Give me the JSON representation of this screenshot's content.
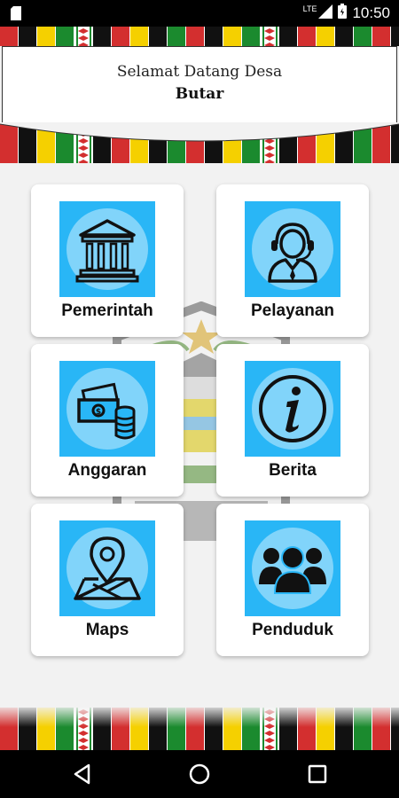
{
  "status_bar": {
    "time": "10:50",
    "network": "LTE",
    "icons": [
      "sd-card-icon",
      "signal-icon",
      "battery-icon"
    ]
  },
  "header": {
    "greeting": "Selamat Datang Desa",
    "village": "Butar"
  },
  "menu": [
    {
      "label": "Pemerintah",
      "icon": "government-building-icon"
    },
    {
      "label": "Pelayanan",
      "icon": "customer-service-icon"
    },
    {
      "label": "Anggaran",
      "icon": "money-icon"
    },
    {
      "label": "Berita",
      "icon": "info-icon"
    },
    {
      "label": "Maps",
      "icon": "map-pin-icon"
    },
    {
      "label": "Penduduk",
      "icon": "people-icon"
    }
  ],
  "colors": {
    "icon_bg": "#29b6f6",
    "icon_circle": "#81d4fa",
    "ulos_red": "#d32f2f",
    "ulos_yellow": "#f5d000",
    "ulos_green": "#1b8a2e",
    "ulos_black": "#111111"
  },
  "nav": {
    "buttons": [
      "back-icon",
      "home-icon",
      "recents-icon"
    ]
  }
}
